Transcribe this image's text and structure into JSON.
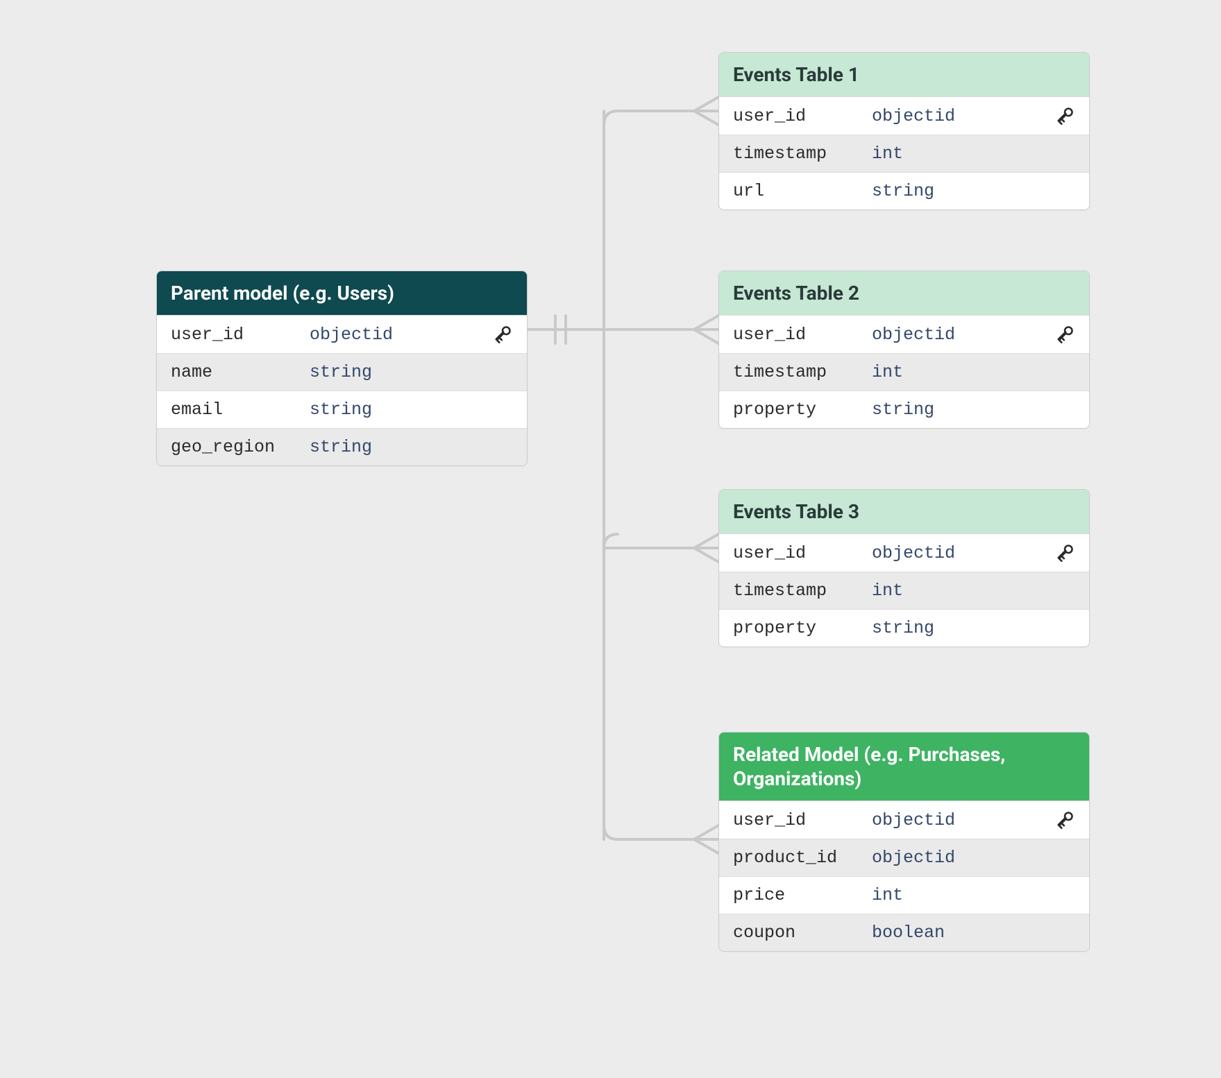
{
  "tables": {
    "parent": {
      "title": "Parent model (e.g. Users)",
      "rows": [
        {
          "name": "user_id",
          "type": "objectid",
          "key": true
        },
        {
          "name": "name",
          "type": "string",
          "key": false
        },
        {
          "name": "email",
          "type": "string",
          "key": false
        },
        {
          "name": "geo_region",
          "type": "string",
          "key": false
        }
      ]
    },
    "events1": {
      "title": "Events Table 1",
      "rows": [
        {
          "name": "user_id",
          "type": "objectid",
          "key": true
        },
        {
          "name": "timestamp",
          "type": "int",
          "key": false
        },
        {
          "name": "url",
          "type": "string",
          "key": false
        }
      ]
    },
    "events2": {
      "title": "Events Table 2",
      "rows": [
        {
          "name": "user_id",
          "type": "objectid",
          "key": true
        },
        {
          "name": "timestamp",
          "type": "int",
          "key": false
        },
        {
          "name": "property",
          "type": "string",
          "key": false
        }
      ]
    },
    "events3": {
      "title": "Events Table 3",
      "rows": [
        {
          "name": "user_id",
          "type": "objectid",
          "key": true
        },
        {
          "name": "timestamp",
          "type": "int",
          "key": false
        },
        {
          "name": "property",
          "type": "string",
          "key": false
        }
      ]
    },
    "related": {
      "title": "Related Model (e.g. Purchases, Organizations)",
      "rows": [
        {
          "name": "user_id",
          "type": "objectid",
          "key": true
        },
        {
          "name": "product_id",
          "type": "objectid",
          "key": false
        },
        {
          "name": "price",
          "type": "int",
          "key": false
        },
        {
          "name": "coupon",
          "type": "boolean",
          "key": false
        }
      ]
    }
  }
}
